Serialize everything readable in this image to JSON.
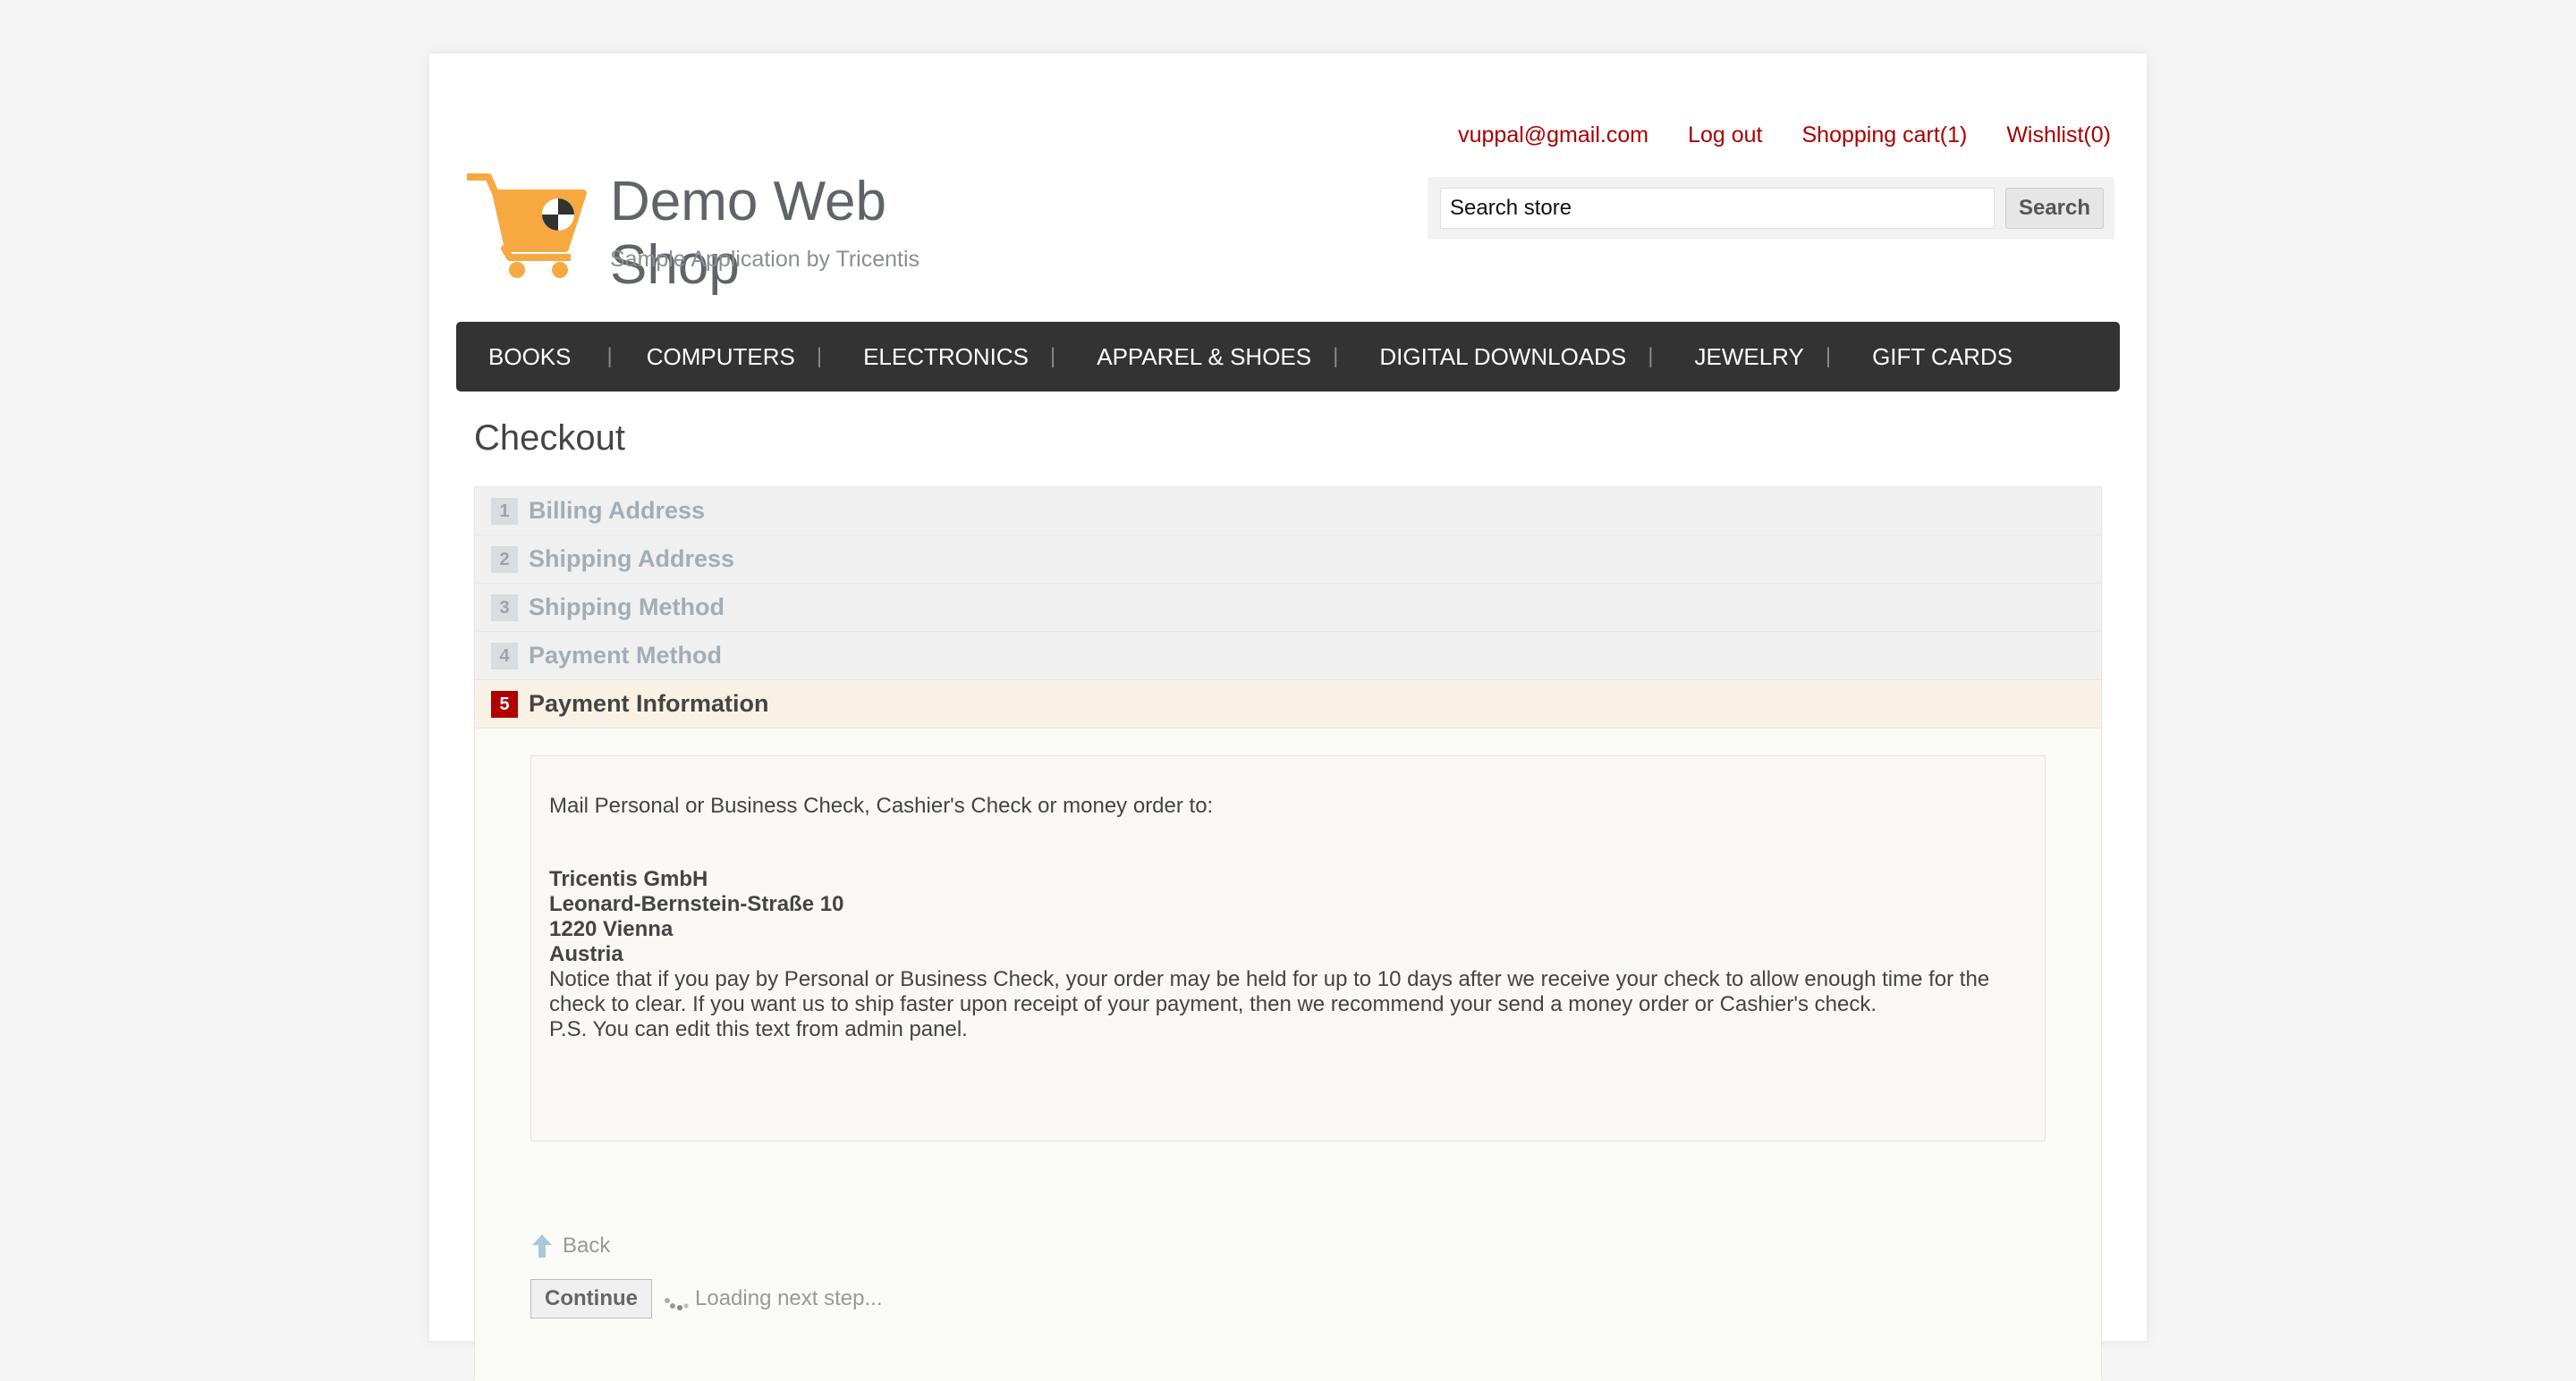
{
  "header": {
    "logo_title": "Demo Web Shop",
    "logo_subtitle": "Sample Application by Tricentis",
    "links": {
      "account": "vuppal@gmail.com",
      "logout": "Log out",
      "cart": "Shopping cart(1)",
      "wishlist": "Wishlist(0)"
    },
    "search": {
      "value": "Search store",
      "button_label": "Search"
    }
  },
  "menu": [
    "BOOKS",
    "COMPUTERS",
    "ELECTRONICS",
    "APPAREL & SHOES",
    "DIGITAL DOWNLOADS",
    "JEWELRY",
    "GIFT CARDS"
  ],
  "checkout": {
    "title": "Checkout",
    "steps": [
      {
        "num": "1",
        "title": "Billing Address"
      },
      {
        "num": "2",
        "title": "Shipping Address"
      },
      {
        "num": "3",
        "title": "Shipping Method"
      },
      {
        "num": "4",
        "title": "Payment Method"
      },
      {
        "num": "5",
        "title": "Payment Information"
      }
    ],
    "payment_info": {
      "intro": "Mail Personal or Business Check, Cashier's Check or money order to:",
      "address": [
        "Tricentis GmbH",
        "Leonard-Bernstein-Straße 10",
        "1220 Vienna",
        "Austria"
      ],
      "notice": "Notice that if you pay by Personal or Business Check, your order may be held for up to 10 days after we receive your check to allow enough time for the check to clear. If you want us to ship faster upon receipt of your payment, then we recommend your send a money order or Cashier's check.",
      "ps": "P.S. You can edit this text from admin panel."
    },
    "back_label": "Back",
    "continue_label": "Continue",
    "loading_text": "Loading next step..."
  },
  "colors": {
    "link_red": "#a90000",
    "menu_bg": "#333333",
    "active_step_bg": "#f9f2e4",
    "active_step_num": "#b00000",
    "logo_orange": "#f7a941"
  },
  "icons": [
    "shopping-cart-logo-icon",
    "back-arrow-icon",
    "loading-spinner-icon"
  ]
}
